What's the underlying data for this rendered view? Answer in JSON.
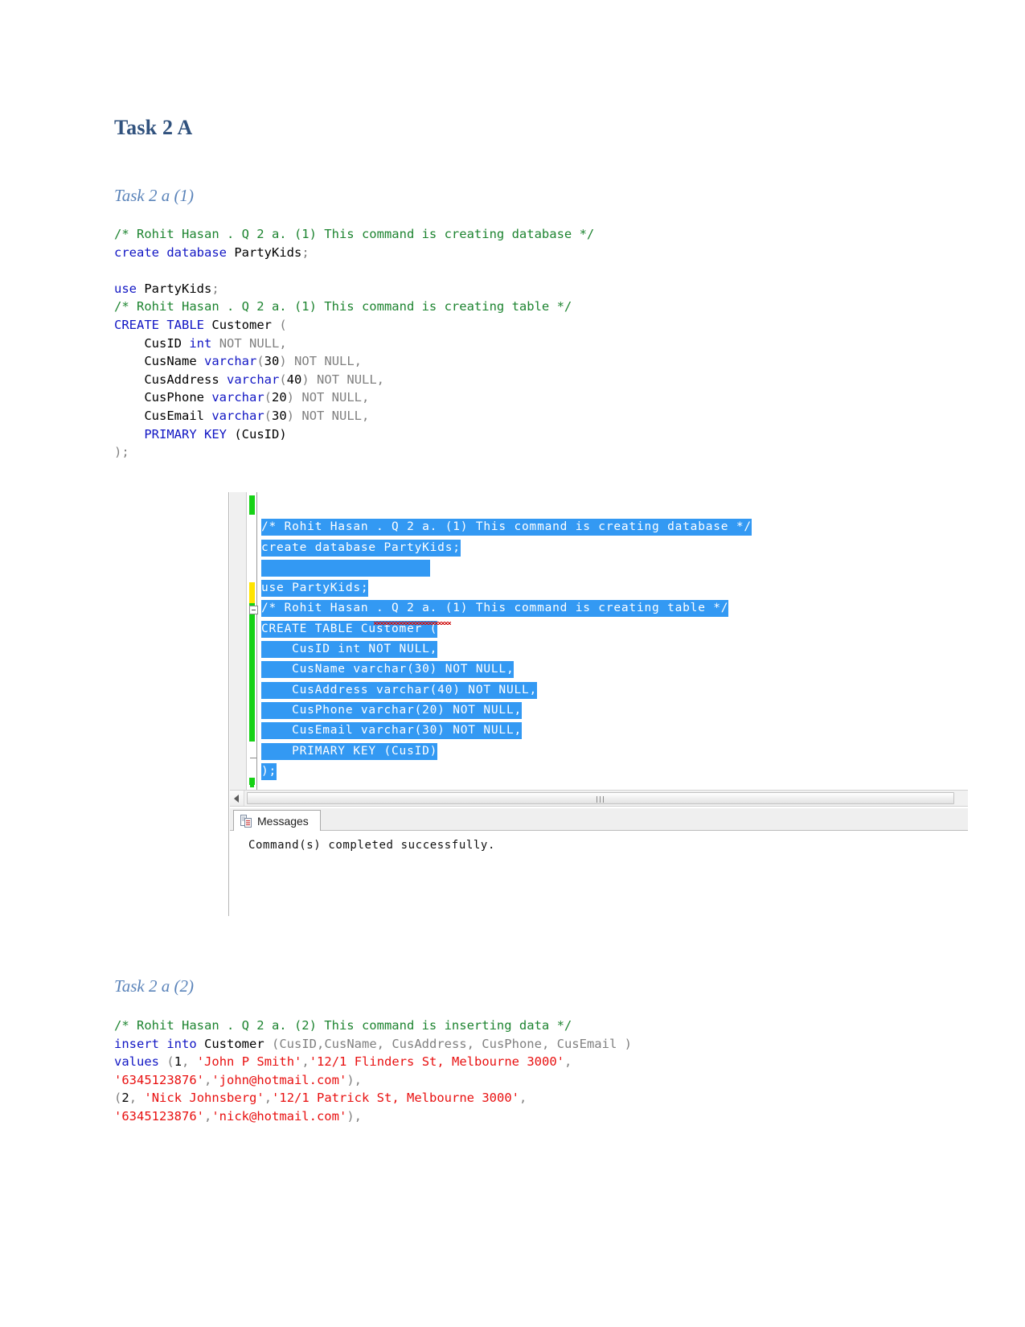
{
  "document": {
    "title": "Task 2 A",
    "section1_heading": "Task 2 a (1)",
    "section2_heading": "Task 2 a (2)"
  },
  "colors": {
    "heading": "#31527e",
    "subheading": "#5b84ba",
    "comment": "#1d8430",
    "keyword": "#1116c4",
    "gray_literal": "#808080",
    "string": "#e81010",
    "selection": "#3399f3",
    "change_green": "#16d216",
    "change_yellow": "#ffe400",
    "squiggle": "#d01010"
  },
  "code_block_1": {
    "lines": [
      "/* Rohit Hasan . Q 2 a. (1) This command is creating database */",
      "create database PartyKids;",
      "",
      "use PartyKids;",
      "/* Rohit Hasan . Q 2 a. (1) This command is creating table */",
      "CREATE TABLE Customer (",
      "    CusID int NOT NULL,",
      "    CusName varchar(30) NOT NULL,",
      "    CusAddress varchar(40) NOT NULL,",
      "    CusPhone varchar(20) NOT NULL,",
      "    CusEmail varchar(30) NOT NULL,",
      "    PRIMARY KEY (CusID)",
      ");"
    ],
    "tokens": {
      "comment_1": "/* Rohit Hasan . Q 2 a. (1) This command is creating database */",
      "kw_create": "create",
      "kw_database": "database",
      "db_name": "PartyKids",
      "kw_use": "use",
      "comment_2": "/* Rohit Hasan . Q 2 a. (1) This command is creating table */",
      "kw_CREATE": "CREATE",
      "kw_TABLE": "TABLE",
      "table_name": "Customer",
      "col1_name": "CusID",
      "col1_type": "int",
      "col2_name": "CusName",
      "col2_type": "varchar",
      "col2_size": "30",
      "col3_name": "CusAddress",
      "col3_type": "varchar",
      "col3_size": "40",
      "col4_name": "CusPhone",
      "col4_type": "varchar",
      "col4_size": "20",
      "col5_name": "CusEmail",
      "col5_type": "varchar",
      "col5_size": "30",
      "not_null": "NOT NULL,",
      "kw_primary_key": "PRIMARY KEY",
      "pk_column": "(CusID)",
      "close_paren": ");"
    }
  },
  "code_block_2": {
    "tokens": {
      "comment_1": "/* Rohit Hasan . Q 2 a. (2) This command is inserting data */",
      "kw_insert": "insert",
      "kw_into": "into",
      "table_name": "Customer",
      "column_list": "(CusID,CusName, CusAddress, CusPhone, CusEmail )",
      "kw_values": "values",
      "row1_id": "1",
      "row1_name": "'John P Smith'",
      "row1_address": "'12/1 Flinders St, Melbourne 3000'",
      "row1_phone": "'6345123876'",
      "row1_email": "'john@hotmail.com'",
      "row2_id": "2",
      "row2_name": "'Nick Johnsberg'",
      "row2_address": "'12/1 Patrick St, Melbourne 3000'",
      "row2_phone": "'6345123876'",
      "row2_email": "'nick@hotmail.com'"
    }
  },
  "ssms": {
    "editor_lines": [
      "/* Rohit Hasan . Q 2 a. (1) This command is creating database */",
      "create database PartyKids;",
      "",
      "use PartyKids;",
      "/* Rohit Hasan . Q 2 a. (1) This command is creating table */",
      "CREATE TABLE Customer (",
      "    CusID int NOT NULL,",
      "    CusName varchar(30) NOT NULL,",
      "    CusAddress varchar(40) NOT NULL,",
      "    CusPhone varchar(20) NOT NULL,",
      "    CusEmail varchar(30) NOT NULL,",
      "    PRIMARY KEY (CusID)",
      ");"
    ],
    "results_tab_label": "Messages",
    "message_text": "Command(s) completed successfully."
  }
}
